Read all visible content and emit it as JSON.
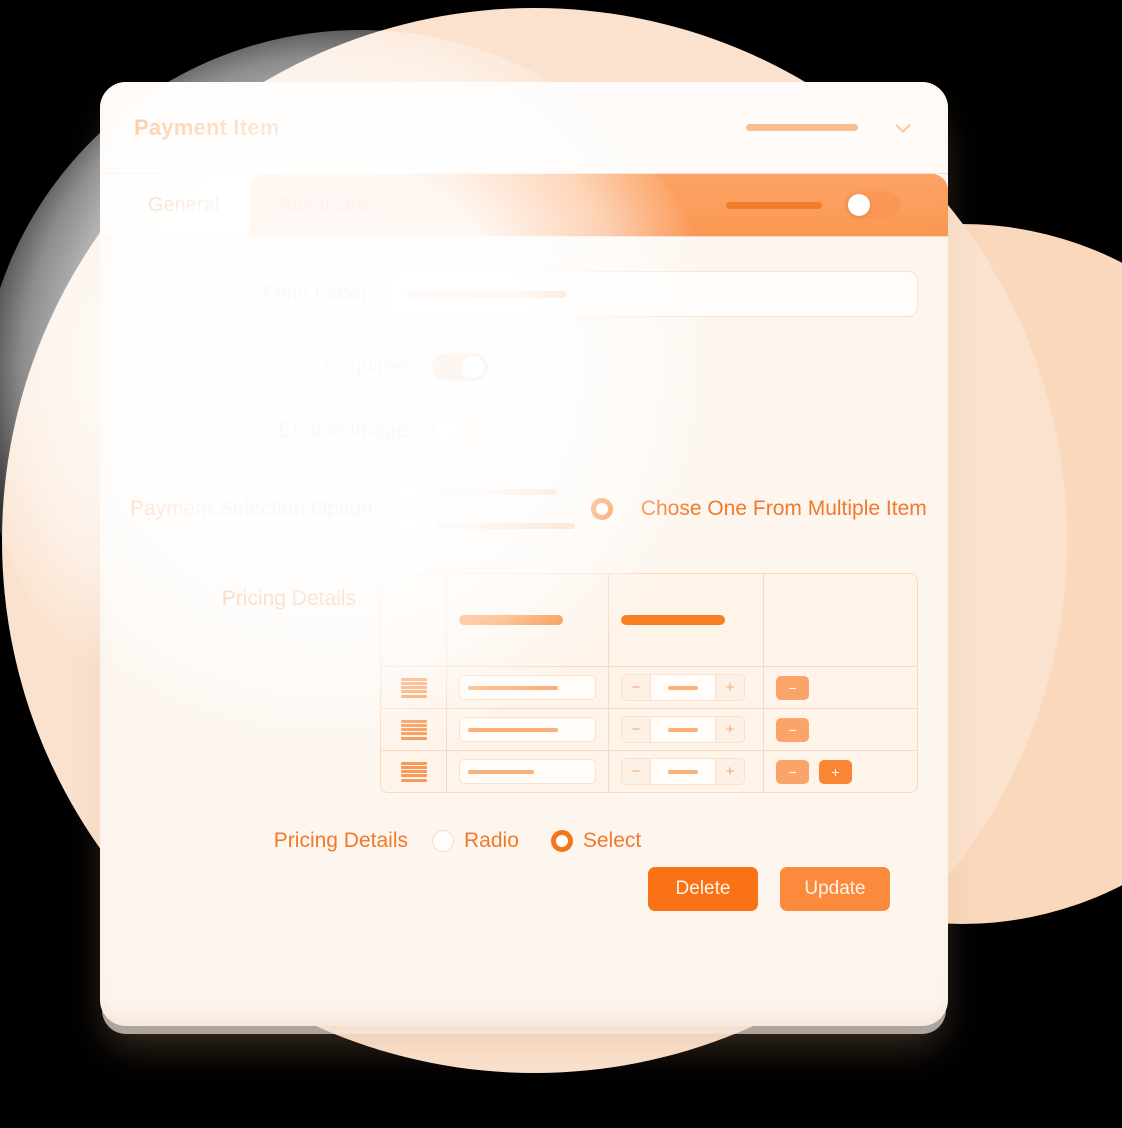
{
  "window": {
    "title": "Payment Item",
    "collapse_icon": "chevron-down-icon"
  },
  "tabs": [
    {
      "label": "General",
      "active": false
    },
    {
      "label": "Advanced",
      "active": true
    }
  ],
  "tab_toggle": {
    "state": "off"
  },
  "form": {
    "field_label": {
      "label": "Field Label",
      "value": ""
    },
    "required": {
      "label": "Required",
      "state": "on"
    },
    "enable_image": {
      "label": "Enable Image",
      "state": "off"
    },
    "payment_selection": {
      "label": "Payment Selection Option",
      "options": [
        {
          "label": "",
          "selected": false
        },
        {
          "label": "",
          "selected": false
        },
        {
          "label": "Chose One From Multiple Item",
          "selected": true
        }
      ]
    },
    "pricing_details": {
      "label": "Pricing Details",
      "columns": [
        "",
        "",
        "",
        ""
      ],
      "rows": [
        {
          "handle": "drag-handle-icon",
          "name": "",
          "qty": "",
          "minus": "−",
          "plus": "+",
          "has_add": false
        },
        {
          "handle": "drag-handle-icon",
          "name": "",
          "qty": "",
          "minus": "−",
          "plus": "+",
          "has_add": false
        },
        {
          "handle": "drag-handle-icon",
          "name": "",
          "qty": "",
          "minus": "−",
          "plus": "+",
          "has_add": true
        }
      ],
      "stepper_minus": "−",
      "stepper_plus": "+",
      "remove_label": "−",
      "add_label": "+"
    },
    "pricing_type": {
      "label": "Pricing Details",
      "options": [
        {
          "label": "Radio",
          "selected": false
        },
        {
          "label": "Select",
          "selected": true
        }
      ]
    }
  },
  "actions": {
    "delete_label": "Delete",
    "update_label": "Update"
  },
  "colors": {
    "accent": "#F97316",
    "accent_light": "#FB8A3C",
    "tab_active": "#FCA264",
    "card_bg": "#FDF6EF",
    "label_text": "#F2792B",
    "circle_main": "#FBE2CE",
    "circle_right": "#F9D8BC"
  }
}
